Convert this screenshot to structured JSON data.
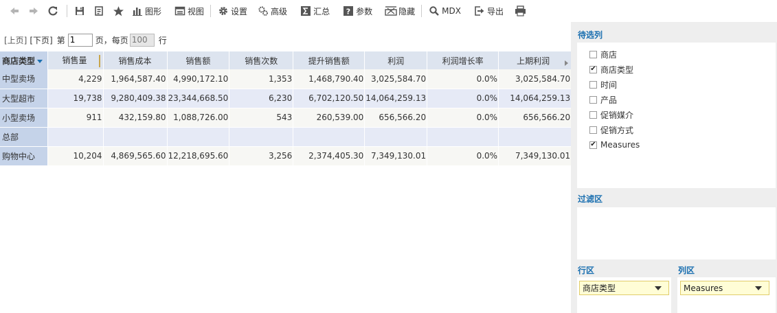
{
  "toolbar": {
    "graph_label": "图形",
    "view_label": "视图",
    "settings_label": "设置",
    "advanced_label": "高级",
    "summary_label": "汇总",
    "params_label": "参数",
    "hide_label": "隐藏",
    "mdx_label": "MDX",
    "export_label": "导出"
  },
  "pager": {
    "prev_label": "[上页]",
    "next_label": "[下页]",
    "page_prefix": "第",
    "page_value": "1",
    "page_suffix": "页，每页",
    "page_size": "100",
    "rows_suffix": "行"
  },
  "grid": {
    "row_header": "商店类型",
    "columns": [
      "销售量",
      "销售成本",
      "销售额",
      "销售次数",
      "提升销售额",
      "利润",
      "利润增长率",
      "上期利润"
    ],
    "rows": [
      {
        "label": "中型卖场",
        "values": [
          "4,229",
          "1,964,587.40",
          "4,990,172.10",
          "1,353",
          "1,468,790.40",
          "3,025,584.70",
          "0.0%",
          "3,025,584.70"
        ]
      },
      {
        "label": "大型超市",
        "values": [
          "19,738",
          "9,280,409.38",
          "23,344,668.50",
          "6,230",
          "6,702,120.50",
          "14,064,259.13",
          "0.0%",
          "14,064,259.13"
        ]
      },
      {
        "label": "小型卖场",
        "values": [
          "911",
          "432,159.80",
          "1,088,726.00",
          "543",
          "260,539.00",
          "656,566.20",
          "0.0%",
          "656,566.20"
        ]
      },
      {
        "label": "总部",
        "values": [
          "",
          "",
          "",
          "",
          "",
          "",
          "",
          ""
        ]
      },
      {
        "label": "购物中心",
        "values": [
          "10,204",
          "4,869,565.60",
          "12,218,695.60",
          "3,256",
          "2,374,405.30",
          "7,349,130.01",
          "0.0%",
          "7,349,130.01"
        ]
      }
    ]
  },
  "panel": {
    "candidates_title": "待选列",
    "fields": [
      {
        "label": "商店",
        "checked": false
      },
      {
        "label": "商店类型",
        "checked": true
      },
      {
        "label": "时间",
        "checked": false
      },
      {
        "label": "产品",
        "checked": false
      },
      {
        "label": "促销媒介",
        "checked": false
      },
      {
        "label": "促销方式",
        "checked": false
      },
      {
        "label": "Measures",
        "checked": true
      }
    ],
    "filter_title": "过滤区",
    "row_area_title": "行区",
    "col_area_title": "列区",
    "row_area_value": "商店类型",
    "col_area_value": "Measures"
  }
}
